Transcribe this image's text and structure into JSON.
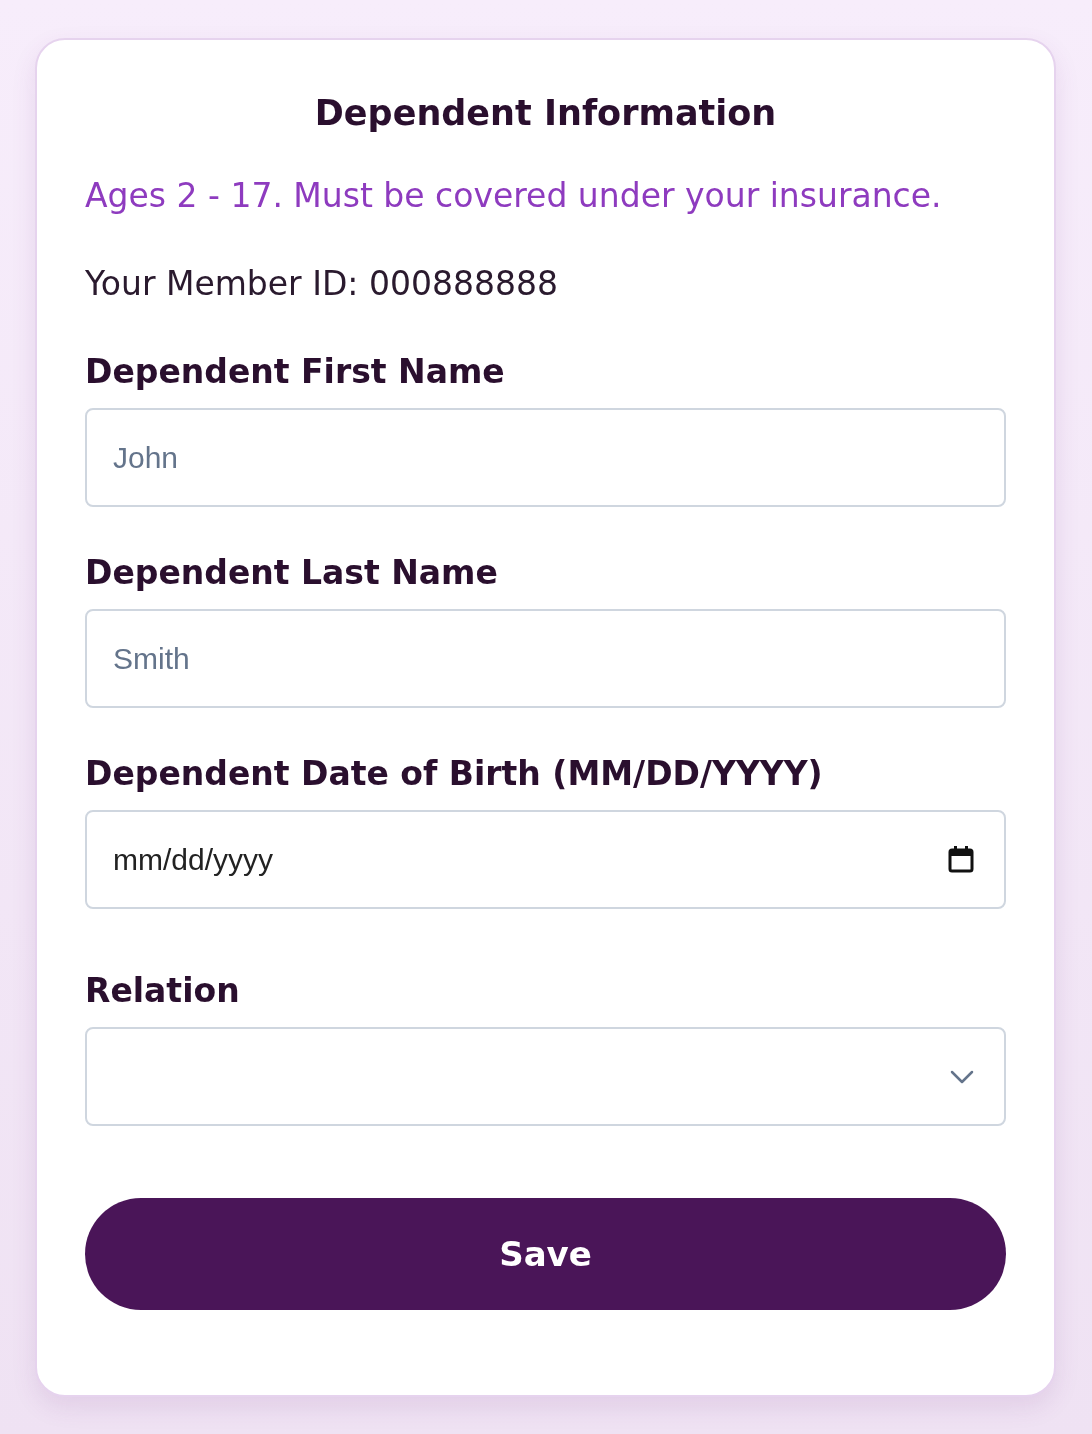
{
  "card": {
    "title": "Dependent Information",
    "notice": "Ages 2 - 17. Must be covered under your insurance.",
    "member_id": "Your Member ID: 000888888"
  },
  "fields": [
    {
      "kind": "text",
      "label": "Dependent First Name",
      "placeholder": "John"
    },
    {
      "kind": "text",
      "label": "Dependent Last Name",
      "placeholder": "Smith"
    },
    {
      "kind": "date",
      "label": "Dependent Date of Birth (MM/DD/YYYY)",
      "placeholder": "mm/dd/yyyy"
    },
    {
      "kind": "select",
      "label": "Relation"
    }
  ],
  "save_button": {
    "label": "Save"
  }
}
